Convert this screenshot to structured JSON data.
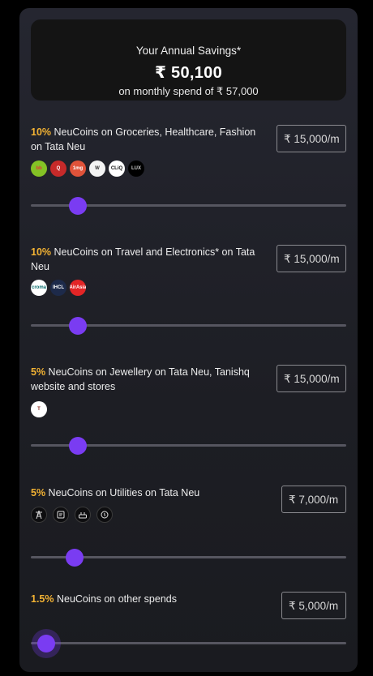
{
  "summary": {
    "label": "Your Annual Savings*",
    "amount": "₹ 50,100",
    "subtext": "on monthly spend of ₹ 57,000"
  },
  "categories": [
    {
      "percent": "10%",
      "text": " NeuCoins on Groceries, Healthcare, Fashion on Tata Neu",
      "amount": "₹ 15,000/m",
      "slider_fraction": 0.15,
      "logos": [
        {
          "name": "bigbasket-logo",
          "text": "bb",
          "bg": "#84c225",
          "fg": "#e2353a"
        },
        {
          "name": "qmin-logo",
          "text": "Q",
          "bg": "#c72a2a",
          "fg": "#ffffff"
        },
        {
          "name": "tata-1mg-logo",
          "text": "1mg",
          "bg": "#e0533a",
          "fg": "#ffffff"
        },
        {
          "name": "westside-logo",
          "text": "W",
          "bg": "#f4f4f4",
          "fg": "#333333"
        },
        {
          "name": "tata-cliq-logo",
          "text": "CLiQ",
          "bg": "#ffffff",
          "fg": "#111111"
        },
        {
          "name": "tata-cliq-luxury-logo",
          "text": "LUX",
          "bg": "#000000",
          "fg": "#cccccc"
        }
      ]
    },
    {
      "percent": "10%",
      "text": " NeuCoins on Travel and Electronics* on Tata Neu",
      "amount": "₹ 15,000/m",
      "slider_fraction": 0.15,
      "logos": [
        {
          "name": "croma-logo",
          "text": "croma",
          "bg": "#ffffff",
          "fg": "#0b6e6e"
        },
        {
          "name": "ihcl-logo",
          "text": "IHCL",
          "bg": "#1d2a4a",
          "fg": "#ffffff"
        },
        {
          "name": "airasia-logo",
          "text": "AirAsia",
          "bg": "#e32526",
          "fg": "#ffffff"
        }
      ]
    },
    {
      "percent": "5%",
      "text": " NeuCoins on Jewellery on Tata Neu, Tanishq website and stores",
      "amount": "₹ 15,000/m",
      "slider_fraction": 0.15,
      "logos": [
        {
          "name": "tanishq-logo",
          "text": "T",
          "bg": "#ffffff",
          "fg": "#8c2a1f"
        }
      ]
    },
    {
      "percent": "5%",
      "text": " NeuCoins on Utilities on Tata Neu",
      "amount": "₹ 7,000/m",
      "slider_fraction": 0.14,
      "utility_icons": [
        "electricity-tower-icon",
        "bill-icon",
        "router-icon",
        "gas-icon"
      ]
    },
    {
      "percent": "1.5%",
      "text": " NeuCoins on other spends",
      "amount": "₹ 5,000/m",
      "slider_fraction": 0.05
    }
  ],
  "colors": {
    "accent": "#7a3cf2",
    "percent": "#f2b233",
    "card_bg": "#22232b"
  }
}
